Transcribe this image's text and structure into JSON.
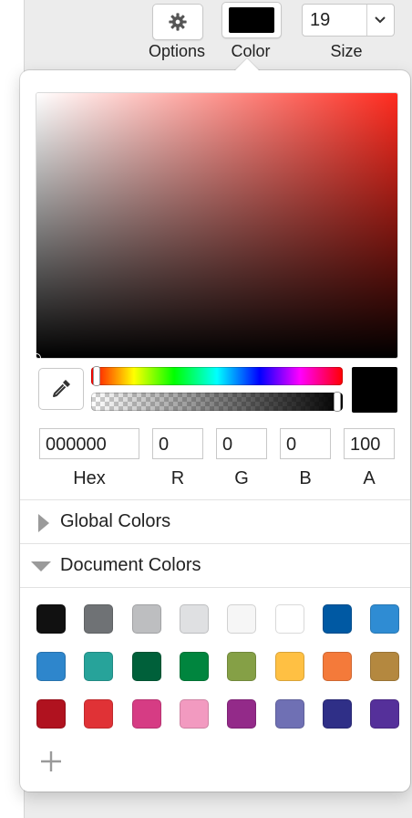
{
  "toolbar": {
    "options_label": "Options",
    "color_label": "Color",
    "size_label": "Size",
    "size_value": "19",
    "current_color": "#000000"
  },
  "picker": {
    "hue_color": "#ff2b1f",
    "hex_value": "000000",
    "r_value": "0",
    "g_value": "0",
    "b_value": "0",
    "a_value": "100",
    "hex_label": "Hex",
    "r_label": "R",
    "g_label": "G",
    "b_label": "B",
    "a_label": "A",
    "alpha_level": 1.0
  },
  "sections": {
    "global_label": "Global Colors",
    "document_label": "Document Colors"
  },
  "document_colors": [
    "#111111",
    "#6f7275",
    "#bdbec0",
    "#dfe0e2",
    "#f6f6f6",
    "#ffffff",
    "#0059a3",
    "#2f8cd3",
    "#2e86cc",
    "#27a39a",
    "#00603a",
    "#00853e",
    "#85a046",
    "#ffc043",
    "#f47a3a",
    "#b4883f",
    "#b0121f",
    "#e03236",
    "#d63c84",
    "#f29ac0",
    "#932a89",
    "#6f70b4",
    "#2f2f87",
    "#55309a"
  ]
}
